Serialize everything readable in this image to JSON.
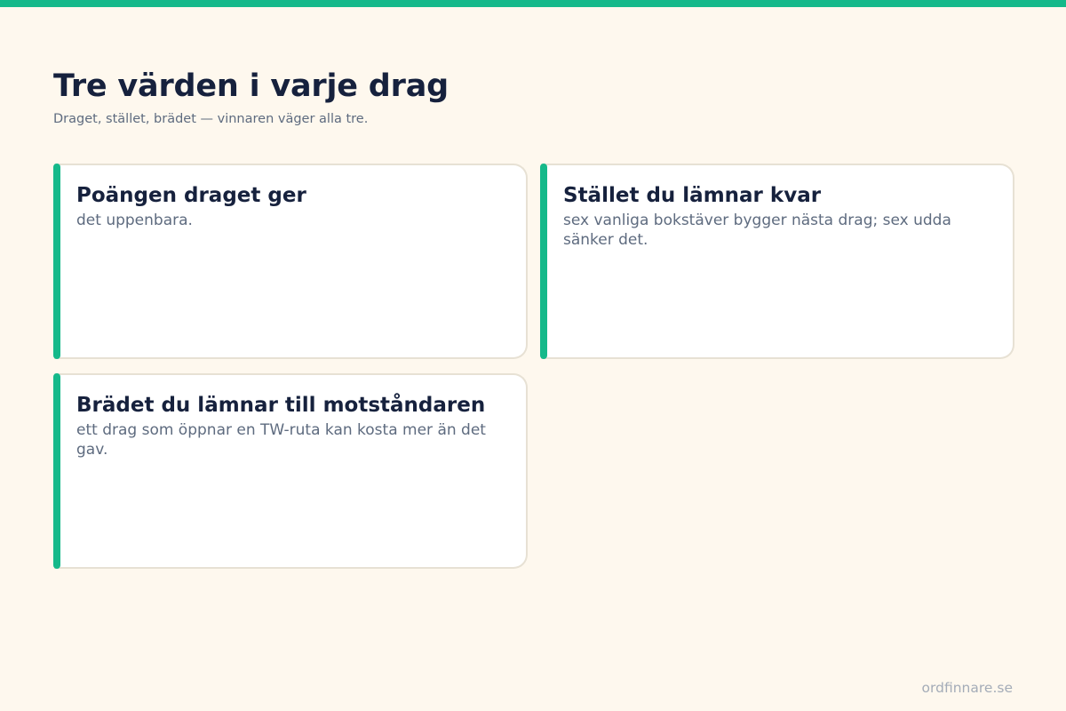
{
  "colors": {
    "background": "#fef8ee",
    "accent": "#15b98a",
    "heading": "#16213d",
    "body_text": "#5e6b7f",
    "card_background": "#ffffff",
    "card_border": "#e7e1d4",
    "footer_text": "#a4acb8"
  },
  "header": {
    "title": "Tre värden i varje drag",
    "subtitle": "Draget, stället, brädet — vinnaren väger alla tre."
  },
  "cards": [
    {
      "heading": "Poängen draget ger",
      "text": "det uppenbara."
    },
    {
      "heading": "Stället du lämnar kvar",
      "text": "sex vanliga bokstäver bygger nästa drag; sex udda sänker det."
    },
    {
      "heading": "Brädet du lämnar till motståndaren",
      "text": "ett drag som öppnar en TW-ruta kan kosta mer än det gav."
    }
  ],
  "footer": {
    "site": "ordfinnare.se"
  }
}
